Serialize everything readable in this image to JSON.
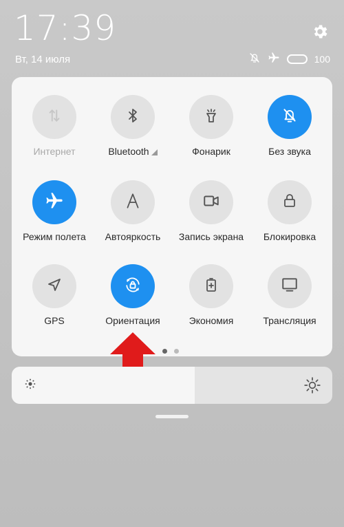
{
  "header": {
    "time": "17:39",
    "date": "Вт, 14 июля",
    "battery_percent": "100",
    "battery_level": 1.0
  },
  "tiles": [
    {
      "label": "Интернет",
      "icon": "data-arrows-icon",
      "active": false,
      "disabled": true
    },
    {
      "label": "Bluetooth",
      "icon": "bluetooth-icon",
      "active": false,
      "disabled": false,
      "has_expand": true
    },
    {
      "label": "Фонарик",
      "icon": "flashlight-icon",
      "active": false,
      "disabled": false
    },
    {
      "label": "Без звука",
      "icon": "bell-off-icon",
      "active": true,
      "disabled": false
    },
    {
      "label": "Режим полета",
      "icon": "airplane-icon",
      "active": true,
      "disabled": false
    },
    {
      "label": "Автояркость",
      "icon": "auto-brightness-icon",
      "active": false,
      "disabled": false
    },
    {
      "label": "Запись экрана",
      "icon": "video-camera-icon",
      "active": false,
      "disabled": false
    },
    {
      "label": "Блокировка",
      "icon": "lock-icon",
      "active": false,
      "disabled": false
    },
    {
      "label": "GPS",
      "icon": "location-arrow-icon",
      "active": false,
      "disabled": false
    },
    {
      "label": "Ориентация",
      "icon": "rotation-lock-icon",
      "active": true,
      "disabled": false
    },
    {
      "label": "Экономия",
      "icon": "battery-saver-icon",
      "active": false,
      "disabled": false
    },
    {
      "label": "Трансляция",
      "icon": "cast-screen-icon",
      "active": false,
      "disabled": false
    }
  ],
  "pager": {
    "pages": 2,
    "current": 1
  },
  "brightness": {
    "level": 0.57
  },
  "colors": {
    "accent": "#1e90f0",
    "annotation_arrow": "#e01b1b"
  }
}
